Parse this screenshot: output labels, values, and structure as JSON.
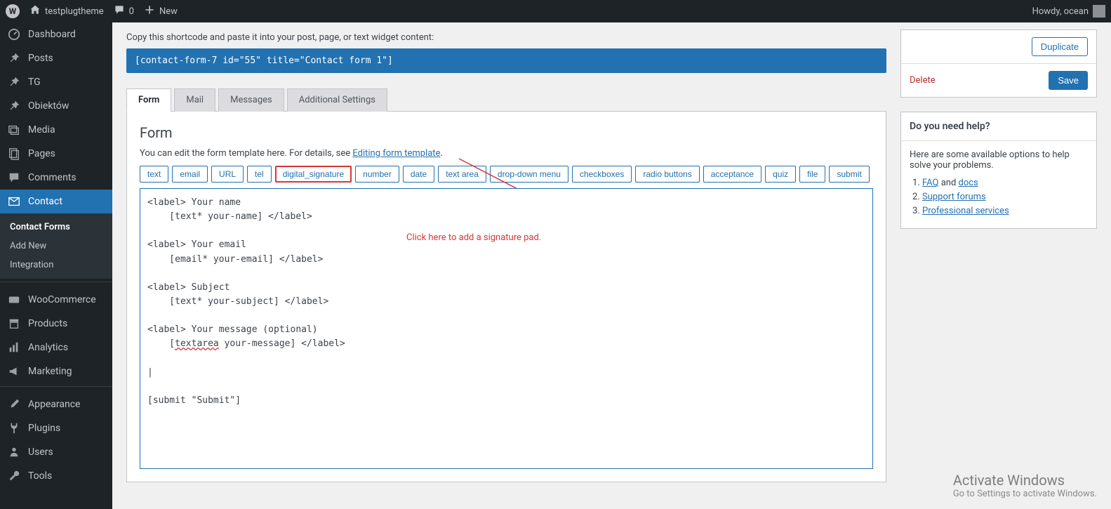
{
  "adminbar": {
    "site_name": "testplugtheme",
    "comments_count": "0",
    "new_label": "New",
    "howdy": "Howdy, ocean"
  },
  "sidebar": {
    "items": [
      {
        "label": "Dashboard",
        "icon": "dashboard"
      },
      {
        "label": "Posts",
        "icon": "pin"
      },
      {
        "label": "TG",
        "icon": "pin"
      },
      {
        "label": "Obiektów",
        "icon": "pin"
      },
      {
        "label": "Media",
        "icon": "media"
      },
      {
        "label": "Pages",
        "icon": "pages"
      },
      {
        "label": "Comments",
        "icon": "comment"
      },
      {
        "label": "Contact",
        "icon": "mail",
        "active": true
      },
      {
        "label": "WooCommerce",
        "icon": "woo"
      },
      {
        "label": "Products",
        "icon": "archive"
      },
      {
        "label": "Analytics",
        "icon": "chart"
      },
      {
        "label": "Marketing",
        "icon": "megaphone"
      },
      {
        "label": "Appearance",
        "icon": "brush"
      },
      {
        "label": "Plugins",
        "icon": "plug"
      },
      {
        "label": "Users",
        "icon": "users"
      },
      {
        "label": "Tools",
        "icon": "tools"
      }
    ],
    "submenu": {
      "items": [
        "Contact Forms",
        "Add New",
        "Integration"
      ],
      "current": 0
    }
  },
  "main": {
    "shortcode_intro": "Copy this shortcode and paste it into your post, page, or text widget content:",
    "shortcode": "[contact-form-7 id=\"55\" title=\"Contact form 1\"]",
    "tabs": [
      "Form",
      "Mail",
      "Messages",
      "Additional Settings"
    ],
    "active_tab": 0,
    "panel_title": "Form",
    "panel_desc_pre": "You can edit the form template here. For details, see ",
    "panel_desc_link": "Editing form template",
    "tag_buttons": [
      "text",
      "email",
      "URL",
      "tel",
      "digital_signature",
      "number",
      "date",
      "text area",
      "drop-down menu",
      "checkboxes",
      "radio buttons",
      "acceptance",
      "quiz",
      "file",
      "submit"
    ],
    "highlight_index": 4,
    "textarea_value": "<label> Your name\n    [text* your-name] </label>\n\n<label> Your email\n    [email* your-email] </label>\n\n<label> Subject\n    [text* your-subject] </label>\n\n<label> Your message (optional)\n    [textarea your-message] </label>\n\n|\n\n[submit \"Submit\"]",
    "annotation": "Click here to add a signature pad."
  },
  "side": {
    "duplicate": "Duplicate",
    "delete": "Delete",
    "save": "Save",
    "help_title": "Do you need help?",
    "help_intro": "Here are some available options to help solve your problems.",
    "help_links_pre": [
      "",
      " and ",
      "",
      ""
    ],
    "help_item1a": "FAQ",
    "help_item1_mid": " and ",
    "help_item1b": "docs",
    "help_item2": "Support forums",
    "help_item3": "Professional services"
  },
  "watermark": {
    "title": "Activate Windows",
    "sub": "Go to Settings to activate Windows."
  }
}
